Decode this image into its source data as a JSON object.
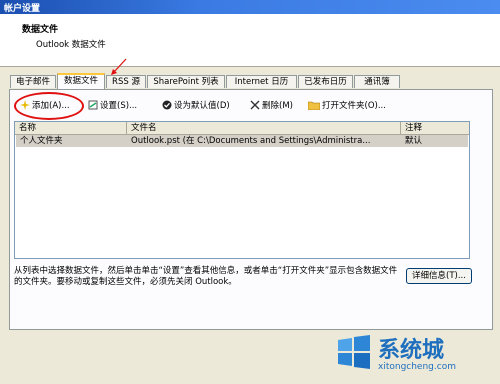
{
  "window": {
    "title": "帐户设置"
  },
  "header": {
    "title": "数据文件",
    "subtitle": "Outlook 数据文件"
  },
  "tabs": [
    {
      "label": "电子邮件",
      "active": false
    },
    {
      "label": "数据文件",
      "active": true
    },
    {
      "label": "RSS 源",
      "active": false
    },
    {
      "label": "SharePoint 列表",
      "active": false
    },
    {
      "label": "Internet 日历",
      "active": false
    },
    {
      "label": "已发布日历",
      "active": false
    },
    {
      "label": "通讯簿",
      "active": false
    }
  ],
  "toolbar": {
    "add": "添加(A)...",
    "settings": "设置(S)...",
    "set_default": "设为默认值(D)",
    "remove": "删除(M)",
    "open_folder": "打开文件夹(O)..."
  },
  "list": {
    "columns": [
      "名称",
      "文件名",
      "注释"
    ],
    "rows": [
      {
        "name": "个人文件夹",
        "file": "Outlook.pst (在 C:\\Documents and Settings\\Administra...",
        "comment": "默认"
      }
    ]
  },
  "description": "从列表中选择数据文件，然后单击单击“设置”查看其他信息，或者单击“打开文件夹”显示包含数据文件的文件夹。要移动或复制这些文件，必须先关闭 Outlook。",
  "buttons": {
    "details": "详细信息(T)..."
  },
  "watermark": {
    "brand": "系统城",
    "url": "xitongcheng.com"
  },
  "colors": {
    "annotation": "#e01010",
    "title_bar": "#1b4fb0",
    "selected_row": "#d4d0c8"
  }
}
